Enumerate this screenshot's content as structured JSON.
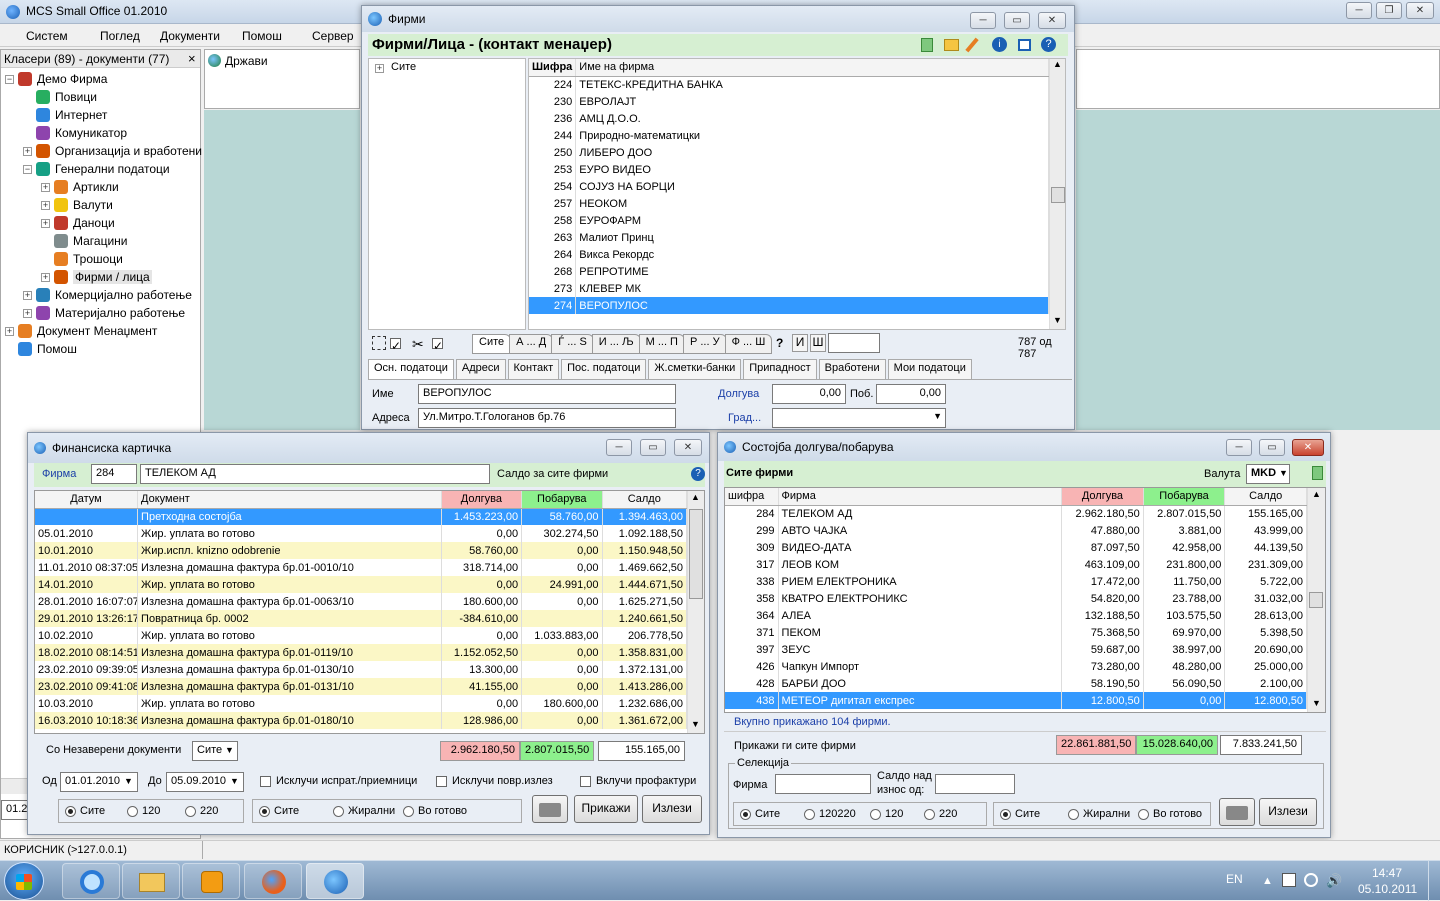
{
  "main_window": {
    "title": "MCS Small Office 01.2010",
    "menu": [
      "Систем",
      "Поглед",
      "Документи",
      "Помош",
      "Сервер"
    ]
  },
  "left_panel": {
    "title": "Класери (89) - документи (77)",
    "close": "×",
    "tree": [
      {
        "label": "Демо Фирма",
        "icon_color": "#c0392b"
      },
      {
        "label": "Повици",
        "icon_color": "#27ae60"
      },
      {
        "label": "Интернет",
        "icon_color": "#2e86de"
      },
      {
        "label": "Комуникатор",
        "icon_color": "#8e44ad"
      },
      {
        "label": "Организација и вработени",
        "icon_color": "#d35400"
      },
      {
        "label": "Генерални податоци",
        "icon_color": "#16a085"
      },
      {
        "label": "Артикли",
        "icon_color": "#e67e22"
      },
      {
        "label": "Валути",
        "icon_color": "#f1c40f"
      },
      {
        "label": "Даноци",
        "icon_color": "#c0392b"
      },
      {
        "label": "Магацини",
        "icon_color": "#7f8c8d"
      },
      {
        "label": "Трошоци",
        "icon_color": "#e67e22"
      },
      {
        "label": "Фирми / лица",
        "icon_color": "#d35400"
      },
      {
        "label": "Комерцијално работење",
        "icon_color": "#2980b9"
      },
      {
        "label": "Материјално работење",
        "icon_color": "#8e44ad"
      },
      {
        "label": "Документ Менаџмент",
        "icon_color": "#e67e22"
      },
      {
        "label": "Помош",
        "icon_color": "#2e86de"
      }
    ],
    "status_cut": "01.2"
  },
  "states_panel": {
    "label": "Држави"
  },
  "firms_window": {
    "title": "Фирми",
    "header": "Фирми/Лица - (контакт менаџер)",
    "tree_root": "Сите",
    "col_code": "Шифра",
    "col_name": "Име на фирма",
    "rows": [
      {
        "code": "224",
        "name": "ТЕТЕКС-КРЕДИТНА БАНКА"
      },
      {
        "code": "230",
        "name": "ЕВРОЛАЈТ"
      },
      {
        "code": "236",
        "name": "АМЦ Д.О.О."
      },
      {
        "code": "244",
        "name": "Природно-математицки"
      },
      {
        "code": "250",
        "name": "ЛИБЕРО ДОО"
      },
      {
        "code": "253",
        "name": "ЕУРО ВИДЕО"
      },
      {
        "code": "254",
        "name": "СОЈУЗ НА БОРЦИ"
      },
      {
        "code": "257",
        "name": "НЕОКОМ"
      },
      {
        "code": "258",
        "name": "ЕУРОФАРМ"
      },
      {
        "code": "263",
        "name": "Малиот Принц"
      },
      {
        "code": "264",
        "name": "Викса Рекордс"
      },
      {
        "code": "268",
        "name": "РЕПРОТИМЕ"
      },
      {
        "code": "273",
        "name": "КЛЕВЕР МК"
      },
      {
        "code": "274",
        "name": "ВЕРОПУЛОС"
      }
    ],
    "alpha_tabs": [
      "Сите",
      "А ... Д",
      "Ѓ ... Ѕ",
      "И ... Љ",
      "М ... П",
      "Р ... У",
      "Ф ... Ш"
    ],
    "q": "?",
    "i": "И",
    "sh": "Ш",
    "count": "787 од 787",
    "tabs": [
      "Осн. податоци",
      "Адреси",
      "Контакт",
      "Пос. податоци",
      "Ж.сметки-банки",
      "Припадност",
      "Вработени",
      "Мои податоци"
    ],
    "name_label": "Име",
    "name_value": "ВЕРОПУЛОС",
    "address_label": "Адреса",
    "address_value": "Ул.Митро.Т.Гологанов бр.76",
    "debit_label": "Долгува",
    "debit_value": "0,00",
    "credit_label": "Поб.",
    "credit_value": "0,00",
    "city_label": "Град..."
  },
  "fin_window": {
    "title": "Финансиска картичка",
    "firm_label": "Фирма",
    "firm_code": "284",
    "firm_name": "ТЕЛЕКОМ АД",
    "saldo_label": "Салдо за сите фирми",
    "cols": [
      "Датум",
      "Документ",
      "Долгува",
      "Побарува",
      "Салдо"
    ],
    "rows": [
      {
        "date": "",
        "doc": "Претходна состојба",
        "d": "1.453.223,00",
        "p": "58.760,00",
        "s": "1.394.463,00",
        "type": "sel"
      },
      {
        "date": "05.01.2010",
        "doc": "Жир. уплата во готово",
        "d": "0,00",
        "p": "302.274,50",
        "s": "1.092.188,50",
        "type": ""
      },
      {
        "date": "10.01.2010",
        "doc": "Жир.испл. knizno odobrenie",
        "d": "58.760,00",
        "p": "0,00",
        "s": "1.150.948,50",
        "type": "yel"
      },
      {
        "date": "11.01.2010 08:37:05",
        "doc": "Излезна домашна фактура бр.01-0010/10",
        "d": "318.714,00",
        "p": "0,00",
        "s": "1.469.662,50",
        "type": ""
      },
      {
        "date": "14.01.2010",
        "doc": "Жир. уплата во готово",
        "d": "0,00",
        "p": "24.991,00",
        "s": "1.444.671,50",
        "type": "yel"
      },
      {
        "date": "28.01.2010 16:07:07",
        "doc": "Излезна домашна фактура бр.01-0063/10",
        "d": "180.600,00",
        "p": "0,00",
        "s": "1.625.271,50",
        "type": ""
      },
      {
        "date": "29.01.2010 13:26:17",
        "doc": "Повратница бр. 0002",
        "d": "-384.610,00",
        "p": "",
        "s": "1.240.661,50",
        "type": "yel"
      },
      {
        "date": "10.02.2010",
        "doc": "Жир. уплата во готово",
        "d": "0,00",
        "p": "1.033.883,00",
        "s": "206.778,50",
        "type": ""
      },
      {
        "date": "18.02.2010 08:14:51",
        "doc": "Излезна домашна фактура бр.01-0119/10",
        "d": "1.152.052,50",
        "p": "0,00",
        "s": "1.358.831,00",
        "type": "yel"
      },
      {
        "date": "23.02.2010 09:39:05",
        "doc": "Излезна домашна фактура бр.01-0130/10",
        "d": "13.300,00",
        "p": "0,00",
        "s": "1.372.131,00",
        "type": ""
      },
      {
        "date": "23.02.2010 09:41:08",
        "doc": "Излезна домашна фактура бр.01-0131/10",
        "d": "41.155,00",
        "p": "0,00",
        "s": "1.413.286,00",
        "type": "yel"
      },
      {
        "date": "10.03.2010",
        "doc": "Жир. уплата во готово",
        "d": "0,00",
        "p": "180.600,00",
        "s": "1.232.686,00",
        "type": ""
      },
      {
        "date": "16.03.2010 10:18:36",
        "doc": "Излезна домашна фактура бр.01-0180/10",
        "d": "128.986,00",
        "p": "0,00",
        "s": "1.361.672,00",
        "type": "yel"
      }
    ],
    "unverified_label": "Со Незаверени документи",
    "unverified_value": "Сите",
    "total_d": "2.962.180,50",
    "total_p": "2.807.015,50",
    "total_s": "155.165,00",
    "from_label": "Од",
    "from_value": "01.01.2010",
    "to_label": "До",
    "to_value": "05.09.2010",
    "cb1": "Исклучи испрат./приемници",
    "cb2": "Исклучи повр.излез",
    "cb3": "Вклучи профактури",
    "r1": [
      "Сите",
      "120",
      "220"
    ],
    "r2": [
      "Сите",
      "Жирални",
      "Во готово"
    ],
    "show": "Прикажи",
    "exit": "Излези"
  },
  "bal_window": {
    "title": "Состојба долгува/побарува",
    "all_firms": "Сите фирми",
    "currency_label": "Валута",
    "currency_value": "MKD",
    "cols": [
      "шифра",
      "Фирма",
      "Долгува",
      "Побарува",
      "Салдо"
    ],
    "rows": [
      {
        "code": "284",
        "name": "ТЕЛЕКОМ АД",
        "d": "2.962.180,50",
        "p": "2.807.015,50",
        "s": "155.165,00"
      },
      {
        "code": "299",
        "name": "АВТО ЧАЈКА",
        "d": "47.880,00",
        "p": "3.881,00",
        "s": "43.999,00"
      },
      {
        "code": "309",
        "name": "ВИДЕО-ДАТА",
        "d": "87.097,50",
        "p": "42.958,00",
        "s": "44.139,50"
      },
      {
        "code": "317",
        "name": "ЛЕОВ КОМ",
        "d": "463.109,00",
        "p": "231.800,00",
        "s": "231.309,00"
      },
      {
        "code": "338",
        "name": "РИЕМ ЕЛЕКТРОНИКА",
        "d": "17.472,00",
        "p": "11.750,00",
        "s": "5.722,00"
      },
      {
        "code": "358",
        "name": "КВАТРО ЕЛЕКТРОНИКС",
        "d": "54.820,00",
        "p": "23.788,00",
        "s": "31.032,00"
      },
      {
        "code": "364",
        "name": "АЛЕА",
        "d": "132.188,50",
        "p": "103.575,50",
        "s": "28.613,00"
      },
      {
        "code": "371",
        "name": "ПЕКОМ",
        "d": "75.368,50",
        "p": "69.970,00",
        "s": "5.398,50"
      },
      {
        "code": "397",
        "name": "ЗЕУС",
        "d": "59.687,00",
        "p": "38.997,00",
        "s": "20.690,00"
      },
      {
        "code": "426",
        "name": "Чапкун Импорт",
        "d": "73.280,00",
        "p": "48.280,00",
        "s": "25.000,00"
      },
      {
        "code": "428",
        "name": "БАРБИ ДОО",
        "d": "58.190,50",
        "p": "56.090,50",
        "s": "2.100,00"
      },
      {
        "code": "438",
        "name": "МЕТЕОР дигитал експрес",
        "d": "12.800,50",
        "p": "0,00",
        "s": "12.800,50"
      }
    ],
    "shown": "Вкупно прикажано 104 фирми.",
    "show_all": "Прикажи ги сите фирми",
    "total_d": "22.861.881,50",
    "total_p": "15.028.640,00",
    "total_s": "7.833.241,50",
    "selection": "Селекција",
    "firm_label": "Фирма",
    "saldo_over": "Салдо над",
    "amount_from": "износ од:",
    "r1": [
      "Сите",
      "120220",
      "120",
      "220"
    ],
    "r2": [
      "Сите",
      "Жирални",
      "Во готово"
    ],
    "exit": "Излези"
  },
  "status_bar": {
    "user": "КОРИСНИК (>127.0.0.1)"
  },
  "taskbar": {
    "lang": "EN",
    "time": "14:47",
    "date": "05.10.2011"
  },
  "colors": {
    "debit": "#f8b4b4",
    "credit": "#8df08d",
    "select": "#3399ff",
    "yellow": "#fbf7c6",
    "green_hdr": "#d6efd2"
  }
}
